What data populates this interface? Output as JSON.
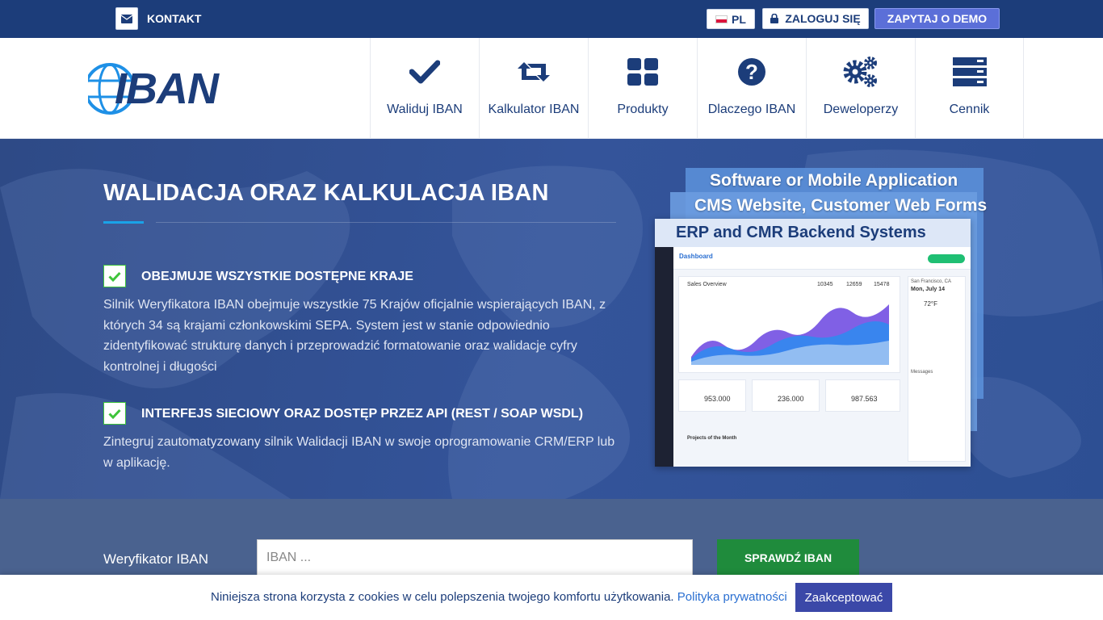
{
  "topbar": {
    "contact_label": "KONTAKT",
    "language": "PL",
    "login_label": "ZALOGUJ SIĘ",
    "demo_label": "ZAPYTAJ O DEMO"
  },
  "logo": {
    "text": "IBAN"
  },
  "nav": {
    "items": [
      {
        "label": "Waliduj IBAN",
        "icon": "check-icon"
      },
      {
        "label": "Kalkulator IBAN",
        "icon": "retweet-icon"
      },
      {
        "label": "Produkty",
        "icon": "grid-icon"
      },
      {
        "label": "Dlaczego IBAN",
        "icon": "question-circle-icon"
      },
      {
        "label": "Deweloperzy",
        "icon": "gears-icon"
      },
      {
        "label": "Cennik",
        "icon": "server-icon"
      }
    ]
  },
  "hero": {
    "title": "WALIDACJA ORAZ KALKULACJA IBAN",
    "features": [
      {
        "title": "OBEJMUJE WSZYSTKIE DOSTĘPNE KRAJE",
        "text": "Silnik Weryfikatora IBAN obejmuje wszystkie 75 Krajów oficjalnie wspierających IBAN, z których 34 są krajami członkowskimi SEPA. System jest w stanie odpowiednio zidentyfikować strukturę danych i przeprowadzić formatowanie oraz walidacje cyfry kontrolnej i długości"
      },
      {
        "title": "INTERFEJS SIECIOWY ORAZ DOSTĘP PRZEZ API (REST / SOAP WSDL)",
        "text": "Zintegruj zautomatyzowany silnik Walidacji IBAN w swoje oprogramowanie CRM/ERP lub w aplikację."
      }
    ],
    "mockup": {
      "label1": "Software or Mobile Application",
      "label2": "CMS Website, Customer Web Forms",
      "label3": "ERP and CMR Backend Systems",
      "dashboard_title": "Dashboard",
      "sales_title": "Sales Overview",
      "stats": [
        "10345",
        "12659",
        "15478"
      ],
      "weather_city": "San Francisco, CA",
      "weather_date": "Mon, July 14",
      "weather_temp": "72°F",
      "totals": [
        "953.000",
        "236.000",
        "987.563"
      ],
      "projects_label": "Projects of the Month",
      "messages_label": "Messages"
    }
  },
  "verifier": {
    "label": "Weryfikator IBAN",
    "placeholder": "IBAN ...",
    "button": "SPRAWDŹ IBAN"
  },
  "cookie": {
    "text": "Niniejsza strona korzysta z cookies w celu polepszenia twojego komfortu użytkowania.",
    "link": "Polityka prywatności",
    "accept": "Zaakceptować"
  },
  "colors": {
    "topbar": "#1c3d7a",
    "demo": "#5b6fd8",
    "hero": "#34549a",
    "check_green": "#3ec43a",
    "verify_button": "#1f8b3c",
    "accept_button": "#3b48a8"
  }
}
